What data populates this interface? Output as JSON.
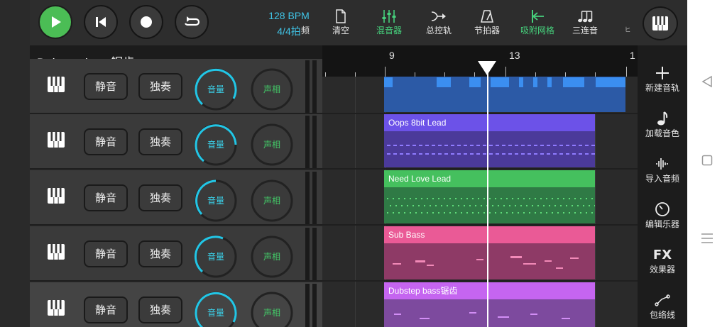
{
  "transport": {
    "bpm": "128 BPM",
    "time_signature": "4/4拍"
  },
  "toolbar": {
    "cut_label": "频",
    "clear": "清空",
    "mixer": "混音器",
    "master": "总控轨",
    "metronome": "节拍器",
    "snap": "吸附网格",
    "triplet": "三连音",
    "more": "ヒ"
  },
  "title": "Dubstep bass锯齿",
  "ruler": {
    "bar9": "9",
    "bar13": "13",
    "bar17": "1"
  },
  "tracks": [
    {
      "mute": "静音",
      "solo": "独奏",
      "volume": "音量",
      "pan": "声相"
    },
    {
      "mute": "静音",
      "solo": "独奏",
      "volume": "音量",
      "pan": "声相"
    },
    {
      "mute": "静音",
      "solo": "独奏",
      "volume": "音量",
      "pan": "声相"
    },
    {
      "mute": "静音",
      "solo": "独奏",
      "volume": "音量",
      "pan": "声相"
    },
    {
      "mute": "静音",
      "solo": "独奏",
      "volume": "音量",
      "pan": "声相"
    }
  ],
  "clips": [
    {
      "name": "",
      "color": "#3b7fe0"
    },
    {
      "name": "Oops 8bit Lead",
      "color": "#6c52e8"
    },
    {
      "name": "Need Love Lead",
      "color": "#45c05e"
    },
    {
      "name": "Sub Bass",
      "color": "#ea5a96"
    },
    {
      "name": "Dubstep bass锯齿",
      "color": "#c565f0"
    }
  ],
  "right_panel": {
    "new_track": "新建音轨",
    "load_sound": "加载音色",
    "import_audio": "导入音频",
    "edit_instrument": "编辑乐器",
    "fx_icon": "FX",
    "effects": "效果器",
    "envelope": "包络线"
  },
  "colors": {
    "accent_green": "#46d07c",
    "accent_cyan": "#40c4e6",
    "play": "#4bbd55"
  }
}
